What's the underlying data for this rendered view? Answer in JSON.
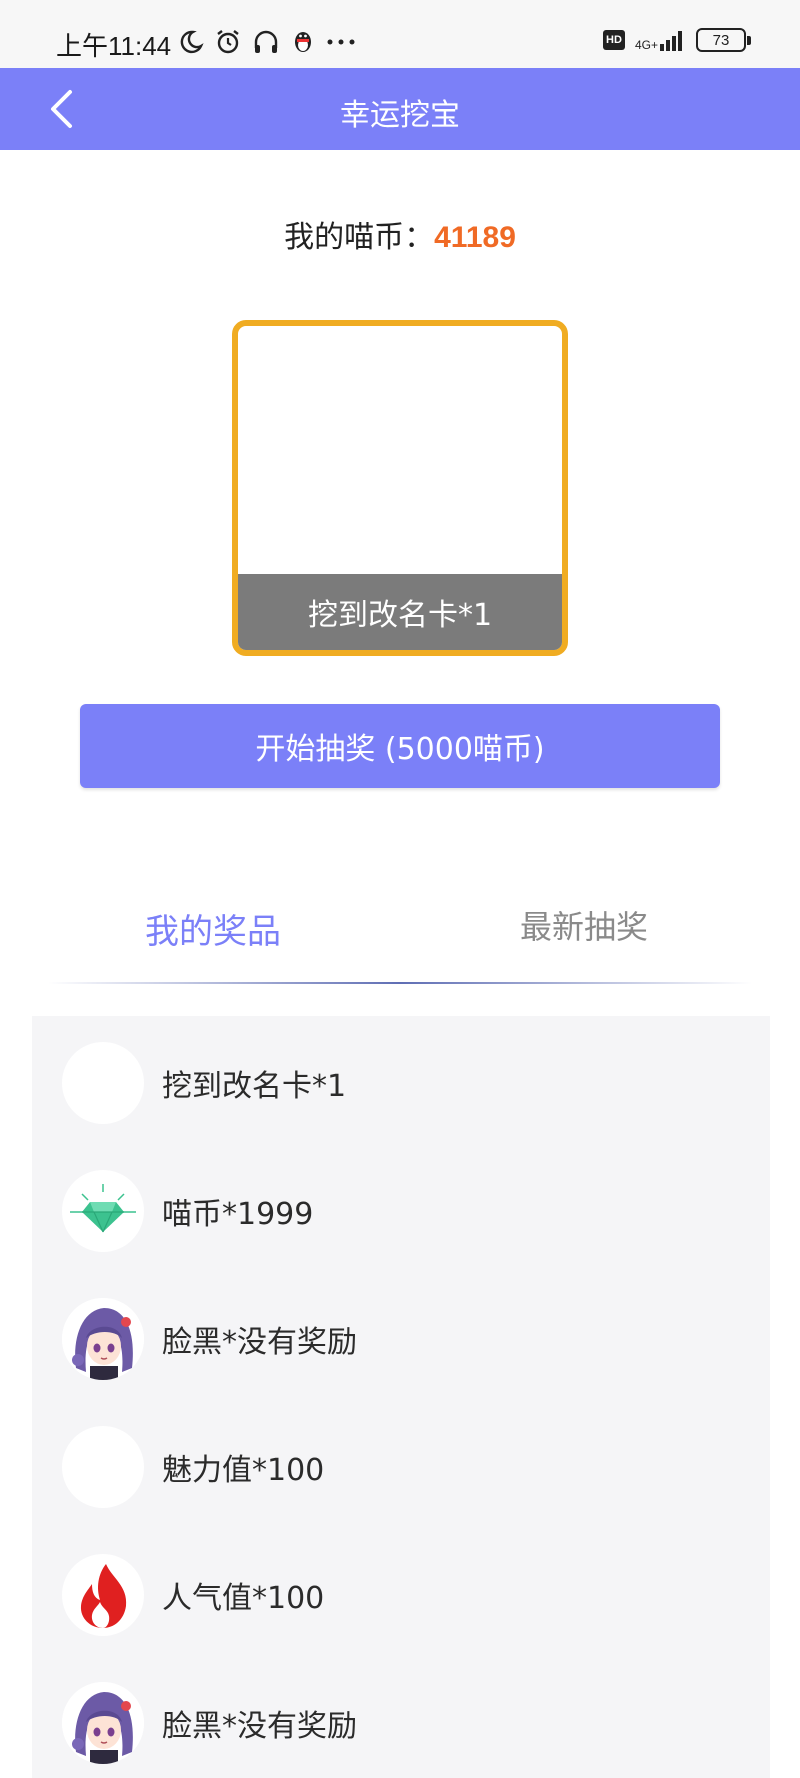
{
  "status_bar": {
    "time": "上午11:44",
    "network_type": "4G+",
    "battery": "73",
    "hd": "HD"
  },
  "header": {
    "title": "幸运挖宝"
  },
  "coins": {
    "label": "我的喵币：",
    "value": "41189"
  },
  "prize_box": {
    "caption": "挖到改名卡*1"
  },
  "draw_button": {
    "label": "开始抽奖 (5000喵币)"
  },
  "tabs": [
    {
      "label": "我的奖品",
      "active": true
    },
    {
      "label": "最新抽奖",
      "active": false
    }
  ],
  "prizes": [
    {
      "label": "挖到改名卡*1",
      "icon": "blank-avatar"
    },
    {
      "label": "喵币*1999",
      "icon": "diamond-icon"
    },
    {
      "label": "脸黑*没有奖励",
      "icon": "anime-girl-avatar"
    },
    {
      "label": "魅力值*100",
      "icon": "blank-avatar"
    },
    {
      "label": "人气值*100",
      "icon": "fire-icon"
    },
    {
      "label": "脸黑*没有奖励",
      "icon": "anime-girl-avatar"
    }
  ],
  "colors": {
    "accent": "#7b80f8",
    "coin_value": "#f06a25",
    "prize_border": "#f0ac22",
    "caption_bg": "#7b7b7b",
    "fire": "#e02020",
    "diamond": "#3cc28f"
  }
}
